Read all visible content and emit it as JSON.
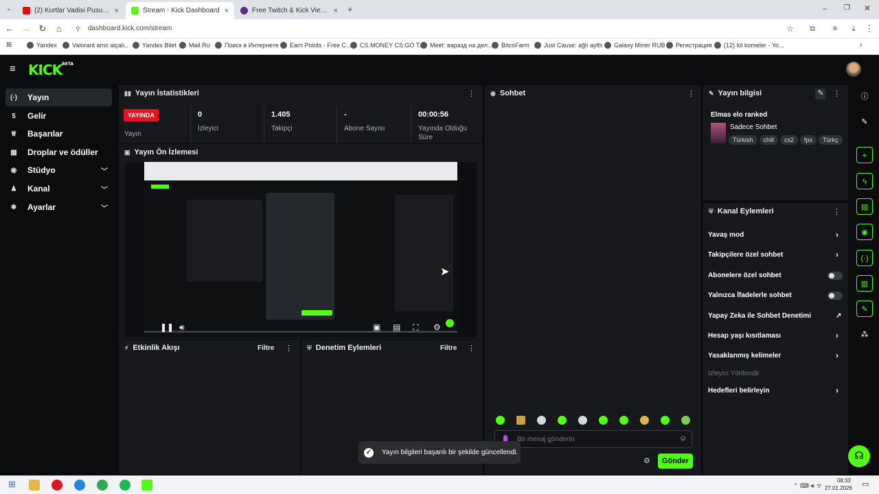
{
  "browser": {
    "tabs": [
      {
        "title": "(2) Kurtlar Vadisi Pusu | Can..",
        "favicon_color": "#ff0000"
      },
      {
        "title": "Stream - Kick Dashboard",
        "favicon_color": "#53fc18"
      },
      {
        "title": "Free Twitch & Kick Viewers - Tr..",
        "favicon_color": "#5b2a86"
      }
    ],
    "url": "dashboard.kick.com/stream",
    "bookmarks": [
      "Yandex",
      "Valorant amo aiçalı..",
      "Yandex Bilet",
      "Mail.Ru",
      "Поиск в Интернете",
      "Earn Points - Free C...",
      "CS.MONEY CS:GO T...",
      "Meet: варазд на дел...",
      "BitcoFarm",
      "Just Cause: ağlı ayltlı",
      "Galaxy Miner RUB",
      "Регистрация",
      "(12) lol komeler - Yo..."
    ]
  },
  "app": {
    "logo": "KICK",
    "logo_badge": "BETA"
  },
  "sidebar": {
    "items": [
      {
        "label": "Yayın",
        "icon": "broadcast-icon",
        "glyph": "(·)"
      },
      {
        "label": "Gelir",
        "icon": "revenue-icon",
        "glyph": "$"
      },
      {
        "label": "Başarılar",
        "icon": "trophy-icon",
        "glyph": "♕"
      },
      {
        "label": "Droplar ve ödüller",
        "icon": "gift-icon",
        "glyph": "▦"
      },
      {
        "label": "Stüdyo",
        "icon": "studio-icon",
        "glyph": "◉"
      },
      {
        "label": "Kanal",
        "icon": "channel-icon",
        "glyph": "♟"
      },
      {
        "label": "Ayarlar",
        "icon": "settings-icon",
        "glyph": "✱"
      }
    ]
  },
  "stats_panel": {
    "title": "Yayın İstatistikleri",
    "live_badge": "YAYINDA",
    "stats": [
      {
        "value": "",
        "label": "Yayın"
      },
      {
        "value": "0",
        "label": "İzleyici"
      },
      {
        "value": "1.405",
        "label": "Takipçi"
      },
      {
        "value": "-",
        "label": "Abone Sayısı"
      },
      {
        "value": "00:00:56",
        "label": "Yayında Olduğu Süre"
      }
    ]
  },
  "preview_panel": {
    "title": "Yayın Ön İzlemesi"
  },
  "activity_panel": {
    "title": "Etkinlik Akışı",
    "filter": "Filtre"
  },
  "moderation_panel": {
    "title": "Denetim Eylemleri",
    "filter": "Filtre"
  },
  "chat_panel": {
    "title": "Sohbet",
    "placeholder": "Bir mesaj gönderin",
    "send": "Gönder"
  },
  "stream_info": {
    "title": "Yayın bilgisi",
    "stream_title": "Elmas elo ranked",
    "category": "Sadece Sohbet",
    "tags": [
      "Türkish",
      "chill",
      "cs2",
      "fps",
      "Türkç"
    ]
  },
  "channel_actions": {
    "title": "Kanal Eylemleri",
    "items": [
      {
        "label": "Yavaş mod",
        "control": "arrow"
      },
      {
        "label": "Takipçilere özel sohbet",
        "control": "arrow"
      },
      {
        "label": "Abonelere özel sohbet",
        "control": "toggle"
      },
      {
        "label": "Yalnızca İfadelerle sohbet",
        "control": "toggle"
      },
      {
        "label": "Yapay Zeka ile Sohbet Denetimi",
        "control": "external"
      },
      {
        "label": "Hesap yaşı kısıtlaması",
        "control": "arrow"
      },
      {
        "label": "Yasaklanmış kelimeler",
        "control": "arrow"
      },
      {
        "label": "İzleyici Yönlendir",
        "control": "disabled"
      },
      {
        "label": "Hedefleri belirleyin",
        "control": "arrow"
      }
    ]
  },
  "toast": {
    "message": "Yayın bilgileri başarılı bir şekilde güncellendi."
  },
  "taskbar": {
    "time": "08:33",
    "date": "27.01.2026"
  }
}
